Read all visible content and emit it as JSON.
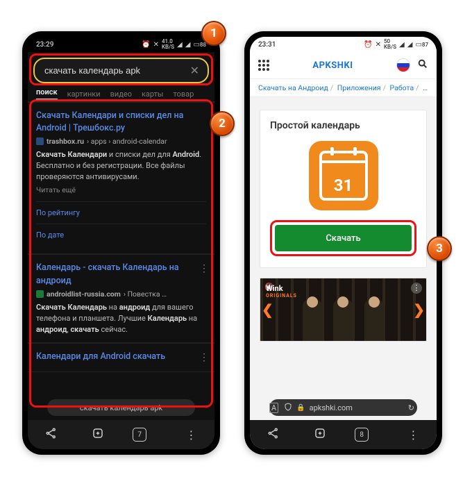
{
  "badges": {
    "one": "1",
    "two": "2",
    "three": "3"
  },
  "left": {
    "status": {
      "time": "23:29",
      "net": "41.0",
      "netUnit": "KB/S",
      "batt": "88"
    },
    "search": {
      "value": "скачать календарь apk"
    },
    "tabs": [
      "поиск",
      "картинки",
      "видео",
      "карты",
      "товар"
    ],
    "results": [
      {
        "title": "Скачать Календари и списки дел на Android | Трешбокс.ру",
        "siteIcon": "blue",
        "site": "trashbox.ru",
        "path": "› apps › android-calendar",
        "body_pre": "Скачать Календари",
        "body_mid1": " и списки дел для ",
        "body_b2": "Android",
        "body_mid2": ". Бесплатно и без регистрации. Все файлы проверяются антивирусами.",
        "readMore": "Читать ещё",
        "sublinks": [
          "По рейтингу",
          "По дате"
        ]
      },
      {
        "title": "Календарь - скачать Календарь на андроид",
        "siteIcon": "green",
        "site": "androidlist-russia.com",
        "path": "› Повестка …",
        "body_b1": "Скачать Календарь",
        "body_mid1": " на ",
        "body_b2": "андроид",
        "body_mid2": " для вашего телефона и планшета. Лучшие ",
        "body_b3": "Календарь",
        "body_mid3": " на ",
        "body_b4": "андроид",
        "body_mid4": ", ",
        "body_b5": "скачать",
        "body_mid5": " сейчас."
      },
      {
        "title": "Календари для Android скачать"
      }
    ],
    "url": "скачать календарь apk",
    "tabCount": "7"
  },
  "right": {
    "status": {
      "time": "23:31",
      "net": "50",
      "netUnit": "KB/S",
      "batt": "87"
    },
    "brand": "APKSHKI",
    "crumbs": [
      "Скачать на Андроид",
      "Приложения",
      "Работа",
      "…"
    ],
    "appTitle": "Простой календарь",
    "calNum": "31",
    "download": "Скачать",
    "ad": {
      "brand": "Wink",
      "sub": "ORIGINALS"
    },
    "urlHost": "apkshki.com",
    "tabCount": "8"
  }
}
